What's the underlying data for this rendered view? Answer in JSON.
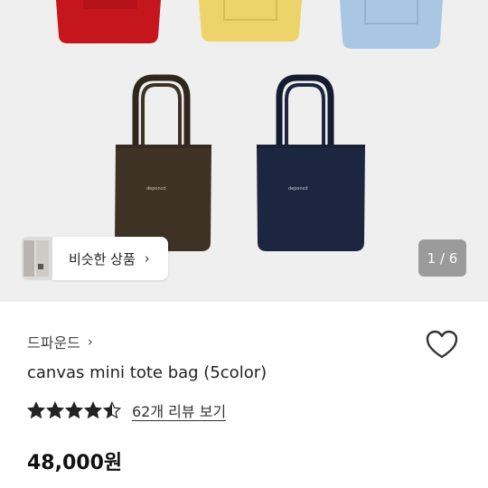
{
  "gallery": {
    "similar_products_label": "비슷한 상품",
    "similar_chevron": "›",
    "page_indicator": "1 / 6",
    "bag_colors": [
      "#c4161c",
      "#ecd36a",
      "#a9c7e2",
      "#3e3225",
      "#1d2640"
    ],
    "bag_logo_text": "deponcd"
  },
  "product": {
    "seller": "드파운드",
    "seller_chevron": "›",
    "name": "canvas mini tote bag (5color)",
    "rating": 4.5,
    "rating_max": 5,
    "review_link": "62개 리뷰 보기",
    "price": "48,000원"
  },
  "icons": {
    "wishlist": "heart-outline-icon",
    "rating": "star-icon"
  }
}
